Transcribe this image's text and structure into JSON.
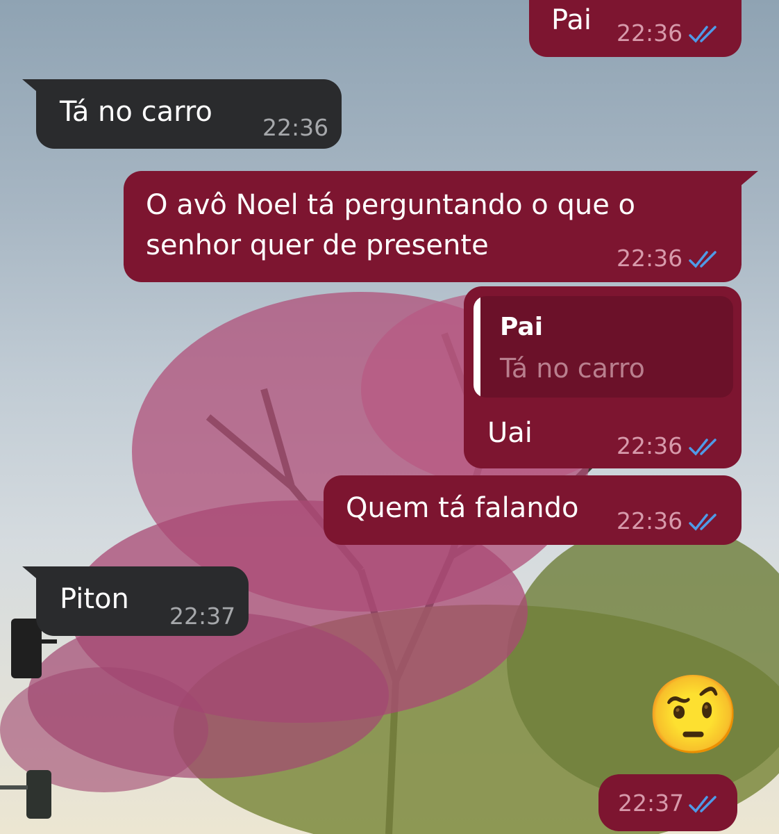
{
  "messages": [
    {
      "direction": "outgoing",
      "text": "Pai",
      "time": "22:36",
      "status": "read"
    },
    {
      "direction": "incoming",
      "text": "Tá no carro",
      "time": "22:36"
    },
    {
      "direction": "outgoing",
      "lines": [
        "O avô Noel tá perguntando o que o",
        "senhor quer de presente"
      ],
      "time": "22:36",
      "status": "read"
    },
    {
      "direction": "outgoing",
      "reply_to": {
        "name": "Pai",
        "text": "Tá no carro"
      },
      "text": "Uai",
      "time": "22:36",
      "status": "read"
    },
    {
      "direction": "outgoing",
      "text": "Quem tá falando",
      "time": "22:36",
      "status": "read"
    },
    {
      "direction": "incoming",
      "text": "Piton",
      "time": "22:37"
    },
    {
      "direction": "outgoing",
      "emoji": "🤨",
      "emoji_name": "raised-eyebrow-face",
      "time": "22:37",
      "status": "read"
    }
  ],
  "colors": {
    "outgoing_bubble": "#7d1530",
    "incoming_bubble": "#2a2b2d",
    "read_ticks": "#4f9be8"
  }
}
